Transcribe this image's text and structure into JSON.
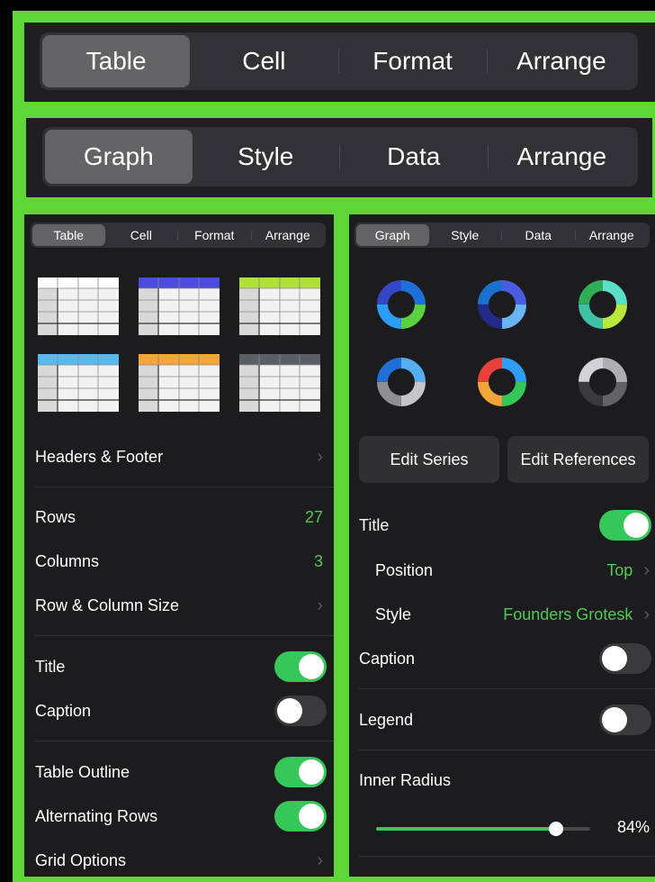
{
  "top_bar_1": {
    "tabs": [
      "Table",
      "Cell",
      "Format",
      "Arrange"
    ],
    "selected": 0
  },
  "top_bar_2": {
    "tabs": [
      "Graph",
      "Style",
      "Data",
      "Arrange"
    ],
    "selected": 0
  },
  "left_panel": {
    "tabs": [
      "Table",
      "Cell",
      "Format",
      "Arrange"
    ],
    "headers_footer": "Headers & Footer",
    "rows_label": "Rows",
    "rows_value": "27",
    "columns_label": "Columns",
    "columns_value": "3",
    "row_col_size": "Row & Column Size",
    "title_label": "Title",
    "title_on": true,
    "caption_label": "Caption",
    "caption_on": false,
    "outline_label": "Table Outline",
    "outline_on": true,
    "alt_rows_label": "Alternating Rows",
    "alt_rows_on": true,
    "grid_options": "Grid Options",
    "table_styles": [
      {
        "header": "#ffffff"
      },
      {
        "header": "#4b4bde"
      },
      {
        "header": "#b1e03a"
      },
      {
        "header": "#5ab8f0"
      },
      {
        "header": "#f6a53a"
      },
      {
        "header": "#5a5f66"
      }
    ]
  },
  "right_panel": {
    "tabs": [
      "Graph",
      "Style",
      "Data",
      "Arrange"
    ],
    "edit_series": "Edit Series",
    "edit_references": "Edit References",
    "title_label": "Title",
    "title_on": true,
    "position_label": "Position",
    "position_value": "Top",
    "style_label": "Style",
    "style_value": "Founders Grotesk",
    "caption_label": "Caption",
    "caption_on": false,
    "legend_label": "Legend",
    "legend_on": false,
    "inner_radius_label": "Inner Radius",
    "inner_radius_value": "84%",
    "inner_radius_fraction": 0.84,
    "donut_styles": [
      {
        "colors": [
          "#1f6fd8",
          "#5bd041",
          "#2a9df4",
          "#3547c9"
        ]
      },
      {
        "colors": [
          "#4a5de0",
          "#6ab4f4",
          "#232b8a",
          "#1b6fcf"
        ]
      },
      {
        "colors": [
          "#5be0c8",
          "#b9e83a",
          "#3fc1a8",
          "#2fae58"
        ]
      },
      {
        "colors": [
          "#55aef0",
          "#c6c6c8",
          "#8e8e93",
          "#1f6fd8"
        ]
      },
      {
        "colors": [
          "#2f9df4",
          "#35c759",
          "#f2a33a",
          "#e8413b"
        ]
      },
      {
        "colors": [
          "#aeaeb2",
          "#636366",
          "#3a3a3c",
          "#d1d1d6"
        ]
      }
    ]
  }
}
